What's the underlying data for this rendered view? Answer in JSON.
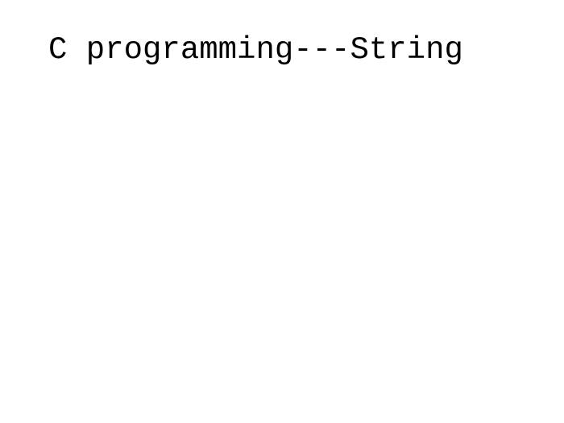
{
  "slide": {
    "title": "C programming---String"
  }
}
